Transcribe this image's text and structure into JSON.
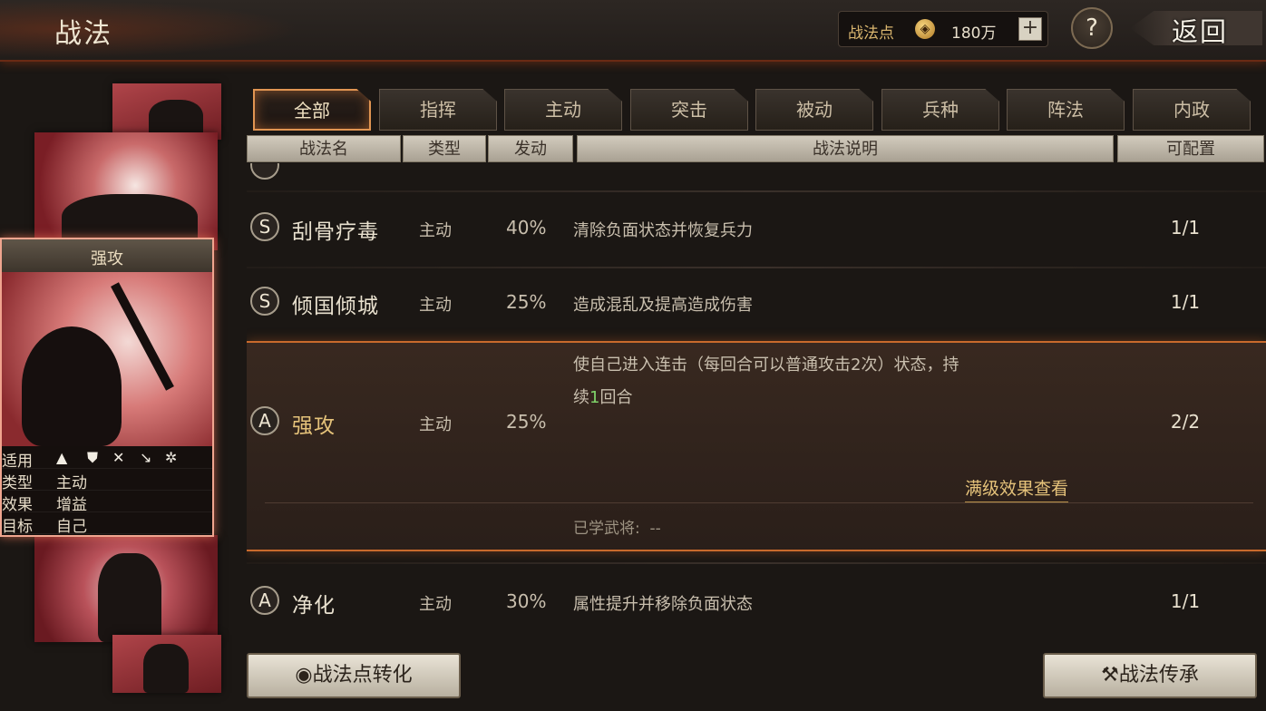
{
  "header": {
    "title": "战法",
    "points_label": "战法点",
    "points_value": "180万",
    "add_label": "+",
    "help_label": "?",
    "back_label": "返回"
  },
  "tabs": [
    {
      "label": "全部",
      "active": true
    },
    {
      "label": "指挥",
      "active": false
    },
    {
      "label": "主动",
      "active": false
    },
    {
      "label": "突击",
      "active": false
    },
    {
      "label": "被动",
      "active": false
    },
    {
      "label": "兵种",
      "active": false
    },
    {
      "label": "阵法",
      "active": false
    },
    {
      "label": "内政",
      "active": false
    }
  ],
  "columns": {
    "name": "战法名",
    "type": "类型",
    "trigger": "发动",
    "desc": "战法说明",
    "config": "可配置"
  },
  "rows": [
    {
      "grade": "S",
      "name": "刮骨疗毒",
      "type": "主动",
      "rate": "40%",
      "desc": "清除负面状态并恢复兵力",
      "config": "1/1"
    },
    {
      "grade": "S",
      "name": "倾国倾城",
      "type": "主动",
      "rate": "25%",
      "desc": "造成混乱及提高造成伤害",
      "config": "1/1"
    },
    {
      "grade": "A",
      "name": "强攻",
      "type": "主动",
      "rate": "25%",
      "desc_line1": "使自己进入连击（每回合可以普通攻击2次）状态，持",
      "desc_line2_pre": "续",
      "desc_line2_num": "1",
      "desc_line2_post": "回合",
      "config": "2/2",
      "full_effect": "满级效果查看",
      "learned_label": "已学武将:",
      "learned_value": "--"
    },
    {
      "grade": "A",
      "name": "净化",
      "type": "主动",
      "rate": "30%",
      "desc": "属性提升并移除负面状态",
      "config": "1/1"
    }
  ],
  "card": {
    "name": "强攻",
    "applicable_label": "适用",
    "type_label": "类型",
    "type_value": "主动",
    "effect_label": "效果",
    "effect_value": "增益",
    "target_label": "目标",
    "target_value": "自己",
    "unit_icons": [
      "cavalry-icon",
      "shield-icon",
      "bow-icon",
      "spear-icon",
      "wheel-icon"
    ]
  },
  "buttons": {
    "convert_label": "战法点转化",
    "inherit_label": "战法传承"
  },
  "colors": {
    "accent": "#e19552",
    "highlight_text": "#e5c27a",
    "number_green": "#7fd36a"
  }
}
